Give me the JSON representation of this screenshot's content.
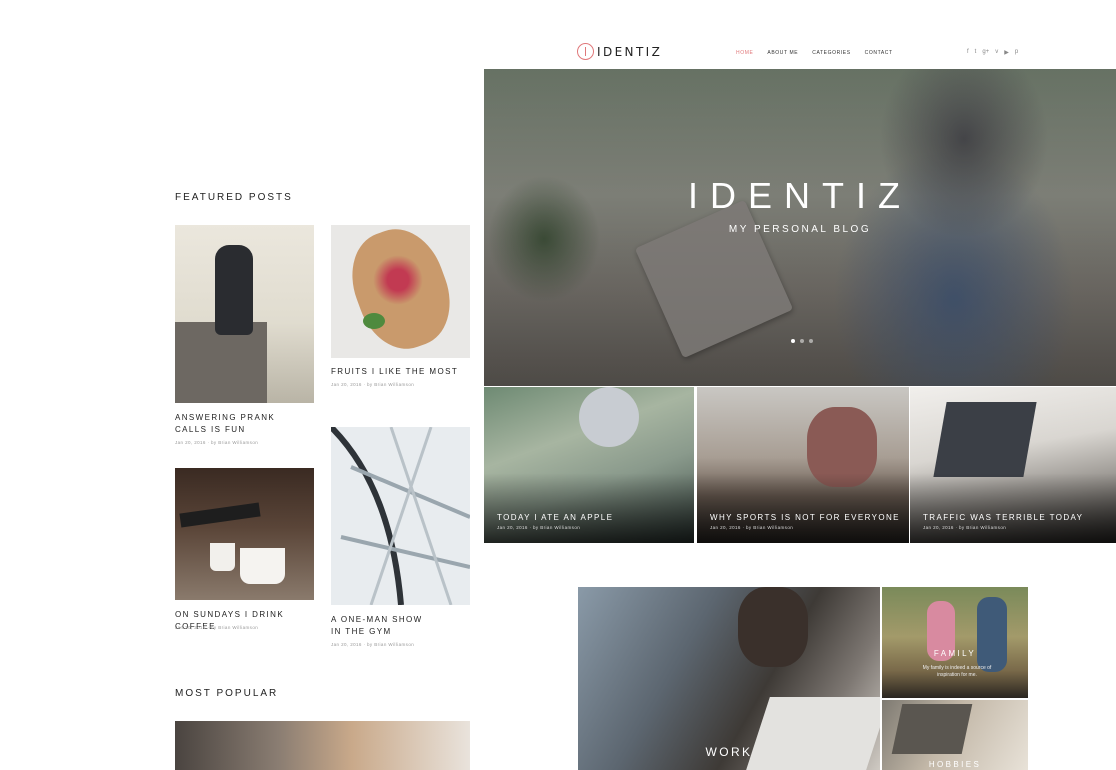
{
  "header": {
    "logo_text": "IDENTIZ",
    "nav": [
      "HOME",
      "ABOUT ME",
      "CATEGORIES",
      "CONTACT"
    ],
    "social_icons": [
      "facebook-icon",
      "twitter-icon",
      "google-plus-icon",
      "vimeo-icon",
      "youtube-icon",
      "pinterest-icon"
    ],
    "social_glyphs": [
      "f",
      "t",
      "g+",
      "v",
      "▶",
      "p"
    ],
    "accent_color": "#e0787a"
  },
  "hero": {
    "title": "IDENTIZ",
    "subtitle": "MY PERSONAL BLOG",
    "slide_count": 3,
    "active_slide": 1
  },
  "hero_tiles": [
    {
      "title": "TODAY I ATE AN APPLE",
      "date": "Jan 20, 2016",
      "author": "by Brian Williamson"
    },
    {
      "title": "WHY SPORTS IS NOT FOR EVERYONE",
      "date": "Jan 20, 2016",
      "author": "by Brian Williamson"
    },
    {
      "title": "TRAFFIC WAS TERRIBLE TODAY",
      "date": "Jan 20, 2016",
      "author": "by Brian Williamson"
    }
  ],
  "featured": {
    "title": "FEATURED POSTS",
    "posts": [
      {
        "title": "ANSWERING PRANK CALLS IS FUN",
        "date": "Jan 20, 2016",
        "author": "by Brian Williamson"
      },
      {
        "title": "FRUITS I LIKE THE MOST",
        "date": "Jan 20, 2016",
        "author": "by Brian Williamson"
      },
      {
        "title": "ON SUNDAYS I DRINK COFFEE",
        "date": "Jan 20, 2016",
        "author": "by Brian Williamson"
      },
      {
        "title": "A ONE-MAN SHOW IN THE GYM",
        "date": "Jan 20, 2016",
        "author": "by Brian Williamson"
      }
    ]
  },
  "popular": {
    "title": "MOST POPULAR"
  },
  "categories": {
    "work": {
      "label": "WORK"
    },
    "family": {
      "label": "FAMILY",
      "text": "My family is indeed a source of inspiration for me."
    },
    "hobbies": {
      "label": "HOBBIES"
    }
  }
}
